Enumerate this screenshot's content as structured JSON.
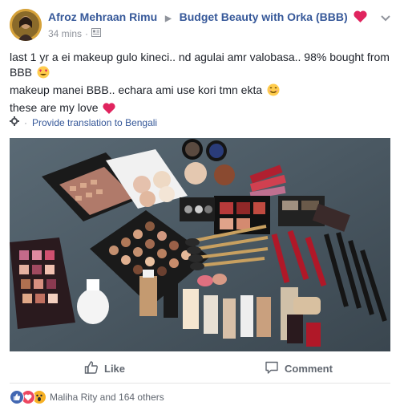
{
  "post": {
    "author": "Afroz Mehraan Rimu",
    "group": "Budget Beauty with Orka (BBB)",
    "time": "34 mins",
    "meta_separator": "·",
    "lines": [
      "last 1 yr a ei makeup gulo kineci.. nd agulai amr valobasa.. 98% bought from BBB",
      "makeup manei BBB.. echara ami use kori tmn ekta",
      "these are my love"
    ],
    "translation_link": "Provide translation to Bengali",
    "translation_dot": "·"
  },
  "actions": {
    "like_label": "Like",
    "comment_label": "Comment"
  },
  "reactions": {
    "summary": "Maliha Rity and 164 others",
    "types": [
      "like",
      "love",
      "wow"
    ]
  },
  "colors": {
    "link": "#365899",
    "text": "#1d2129",
    "muted": "#90949c",
    "like_blue": "#4267b2",
    "love_red": "#ed4760"
  },
  "icons": {
    "arrow": "right-triangle-icon",
    "privacy": "group-privacy-icon",
    "translate": "gear-icon",
    "like": "thumbs-up-icon",
    "comment": "speech-bubble-icon"
  }
}
